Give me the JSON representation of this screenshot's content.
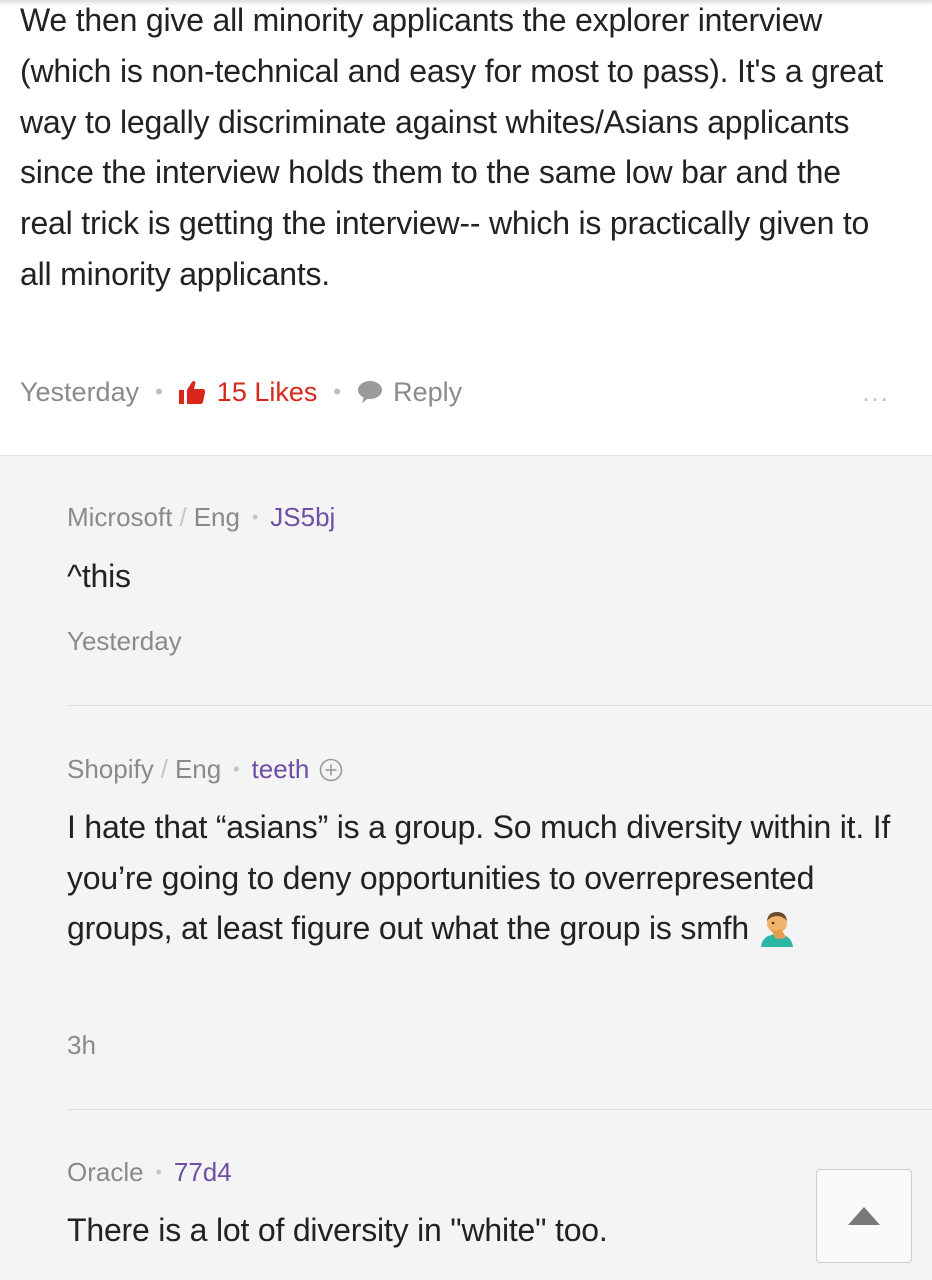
{
  "main_post": {
    "body": "We then give all minority applicants the explorer interview (which is non-technical and easy for most to pass). It's a great way to legally discriminate against whites/Asians applicants since the interview holds them to the same low bar and the real trick is getting the interview-- which is practically given to all minority applicants.",
    "time": "Yesterday",
    "likes": "15 Likes",
    "reply_label": "Reply",
    "more": "..."
  },
  "replies": [
    {
      "company": "Microsoft",
      "role": "Eng",
      "user": "JS5bj",
      "text": "^this",
      "time": "Yesterday"
    },
    {
      "company": "Shopify",
      "role": "Eng",
      "user": "teeth",
      "text": "I hate that “asians” is a group. So much diversity within it. If you’re going to deny opportunities to overrepresented groups, at least figure out what the group is smfh",
      "emoji": "man-facepalming-icon",
      "time": "3h"
    },
    {
      "company": "Oracle",
      "user": "77d4",
      "text": "There is a lot of diversity in \"white\" too."
    }
  ],
  "colors": {
    "like_red": "#d9261c",
    "username_purple": "#6e4fa5",
    "meta_gray": "#8a8a8a",
    "thread_background": "#f4f4f4"
  }
}
